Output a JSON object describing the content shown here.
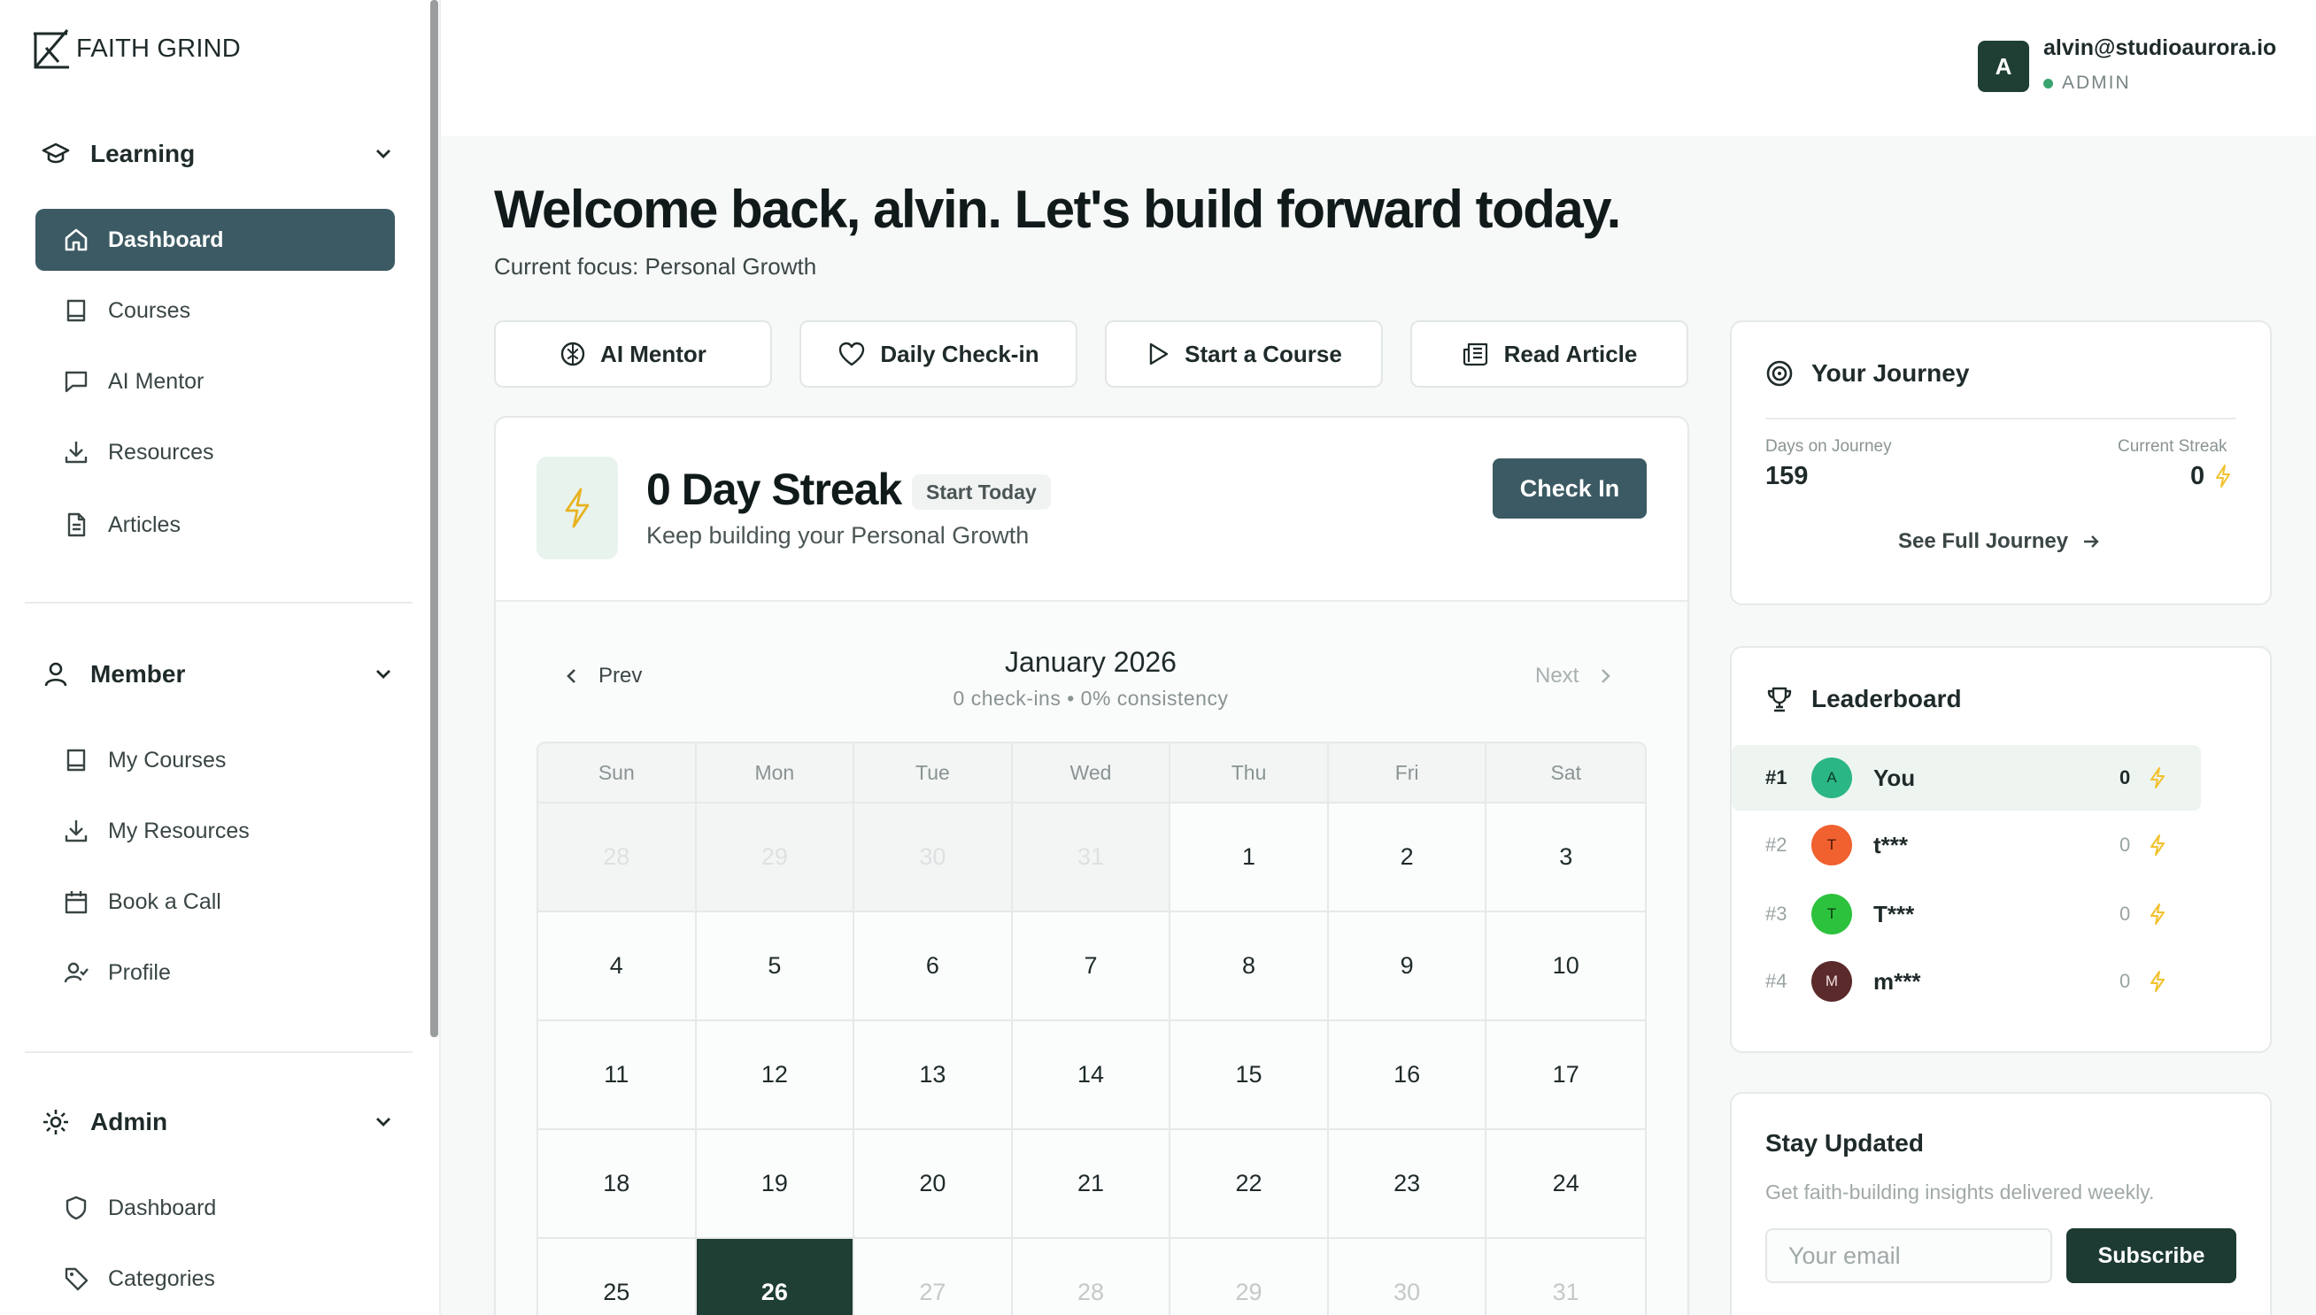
{
  "brand": {
    "name": "FAITH GRIND"
  },
  "sidebar": {
    "sections": [
      {
        "title": "Learning",
        "items": [
          "Dashboard",
          "Courses",
          "AI Mentor",
          "Resources",
          "Articles"
        ]
      },
      {
        "title": "Member",
        "items": [
          "My Courses",
          "My Resources",
          "Book a Call",
          "Profile"
        ]
      },
      {
        "title": "Admin",
        "items": [
          "Dashboard",
          "Categories"
        ]
      }
    ],
    "active_item": "Dashboard"
  },
  "user": {
    "avatar_initial": "A",
    "email": "alvin@studioaurora.io",
    "role": "ADMIN"
  },
  "welcome": {
    "title": "Welcome back, alvin. Let's build forward today.",
    "focus": "Current focus: Personal Growth"
  },
  "quick_actions": [
    "AI Mentor",
    "Daily Check-in",
    "Start a Course",
    "Read Article"
  ],
  "streak": {
    "title": "0 Day Streak",
    "badge": "Start Today",
    "subtitle": "Keep building your Personal Growth",
    "checkin_label": "Check In"
  },
  "calendar": {
    "prev_label": "Prev",
    "next_label": "Next",
    "month": "January 2026",
    "stats": "0 check-ins • 0% consistency",
    "weekdays": [
      "Sun",
      "Mon",
      "Tue",
      "Wed",
      "Thu",
      "Fri",
      "Sat"
    ],
    "weeks": [
      [
        "28",
        "29",
        "30",
        "31",
        "1",
        "2",
        "3"
      ],
      [
        "4",
        "5",
        "6",
        "7",
        "8",
        "9",
        "10"
      ],
      [
        "11",
        "12",
        "13",
        "14",
        "15",
        "16",
        "17"
      ],
      [
        "18",
        "19",
        "20",
        "21",
        "22",
        "23",
        "24"
      ],
      [
        "25",
        "26",
        "27",
        "28",
        "29",
        "30",
        "31"
      ]
    ],
    "today": "26"
  },
  "journey": {
    "title": "Your Journey",
    "days_label": "Days on Journey",
    "days_value": "159",
    "streak_label": "Current Streak",
    "streak_value": "0",
    "link_label": "See Full Journey"
  },
  "leaderboard": {
    "title": "Leaderboard",
    "rows": [
      {
        "rank": "#1",
        "initial": "A",
        "name": "You",
        "score": "0",
        "color": "#2bb685"
      },
      {
        "rank": "#2",
        "initial": "T",
        "name": "t***",
        "score": "0",
        "color": "#f0612f"
      },
      {
        "rank": "#3",
        "initial": "T",
        "name": "T***",
        "score": "0",
        "color": "#2dc23d"
      },
      {
        "rank": "#4",
        "initial": "M",
        "name": "m***",
        "score": "0",
        "color": "#5b2a2a"
      }
    ]
  },
  "newsletter": {
    "title": "Stay Updated",
    "description": "Get faith-building insights delivered weekly.",
    "placeholder": "Your email",
    "button_label": "Subscribe"
  },
  "colors": {
    "primary": "#3c5a63",
    "dark": "#1f3e34",
    "bolt": "#f2c12e"
  }
}
